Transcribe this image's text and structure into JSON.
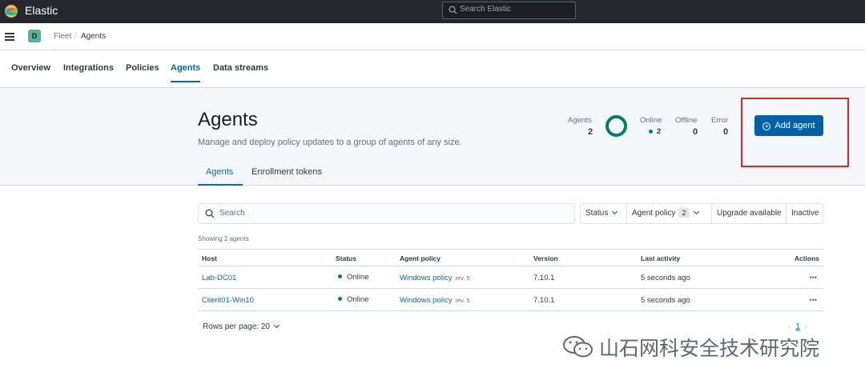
{
  "app": {
    "title": "Elastic",
    "search_placeholder": "Search Elastic"
  },
  "breadcrumb": {
    "space": "D",
    "items": [
      "Fleet",
      "Agents"
    ]
  },
  "nav": {
    "tabs": [
      "Overview",
      "Integrations",
      "Policies",
      "Agents",
      "Data streams"
    ],
    "active": "Agents"
  },
  "page": {
    "title": "Agents",
    "description": "Manage and deploy policy updates to a group of agents of any size.",
    "add_button": "Add agent",
    "subtabs": [
      "Agents",
      "Enrollment tokens"
    ]
  },
  "stats": {
    "agents_label": "Agents",
    "agents": "2",
    "online_label": "Online",
    "online": "2",
    "offline_label": "Offline",
    "offline": "0",
    "error_label": "Error",
    "error": "0"
  },
  "filters": {
    "search_placeholder": "Search",
    "status": "Status",
    "agent_policy": "Agent policy",
    "agent_policy_count": "2",
    "upgrade": "Upgrade available",
    "inactive": "Inactive"
  },
  "table": {
    "showing": "Showing 2 agents",
    "columns": [
      "Host",
      "Status",
      "Agent policy",
      "Version",
      "Last activity",
      "Actions"
    ],
    "rows": [
      {
        "host": "Lab-DC01",
        "status": "Online",
        "policy": "Windows policy",
        "rev": "rev. 5",
        "version": "7.10.1",
        "activity": "5 seconds ago"
      },
      {
        "host": "Client01-Win10",
        "status": "Online",
        "policy": "Windows policy",
        "rev": "rev. 5",
        "version": "7.10.1",
        "activity": "5 seconds ago"
      }
    ]
  },
  "pagination": {
    "rows_per_page": "Rows per page: 20",
    "page": "1"
  },
  "watermark": "山石网科安全技术研究院",
  "colors": {
    "topbar": "#25282f",
    "primary": "#0061a6",
    "link": "#006bb8",
    "online": "#017d73",
    "highlight": "#e0242c"
  },
  "icons": [
    "elastic-logo-icon",
    "search-icon",
    "menu-icon",
    "chevron-down-icon",
    "plus-circle-icon",
    "more-actions-icon",
    "wechat-icon"
  ]
}
